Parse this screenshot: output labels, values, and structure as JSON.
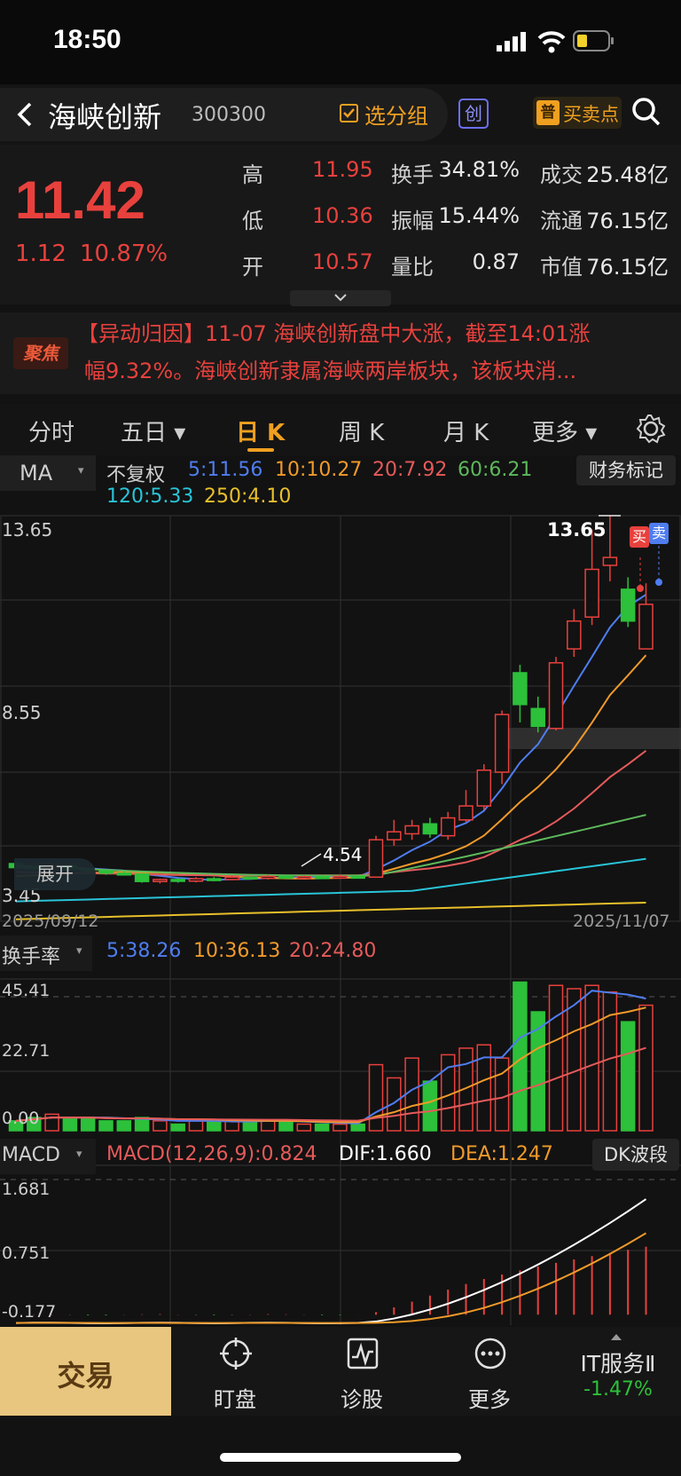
{
  "status_bar": {
    "time": "18:50"
  },
  "header": {
    "stock_name": "海峡创新",
    "stock_code": "300300",
    "group_label": "选分组",
    "chuang_badge": "创",
    "pu_badge": "普",
    "buy_sell_label": "买卖点"
  },
  "quote": {
    "price": "11.42",
    "change": "1.12",
    "change_pct": "10.87%",
    "rows": [
      {
        "l1": "高",
        "v1": "11.95",
        "l2": "换手",
        "v2": "34.81%",
        "l3": "成交",
        "v3": "25.48亿"
      },
      {
        "l1": "低",
        "v1": "10.36",
        "l2": "振幅",
        "v2": "15.44%",
        "l3": "流通",
        "v3": "76.15亿"
      },
      {
        "l1": "开",
        "v1": "10.57",
        "l2": "量比",
        "v2": "0.87",
        "l3": "市值",
        "v3": "76.15亿"
      }
    ]
  },
  "news": {
    "badge": "聚焦",
    "line1": "【异动归因】11-07 海峡创新盘中大涨，截至14:01涨",
    "line2": "幅9.32%。海峡创新隶属海峡两岸板块，该板块消..."
  },
  "tabs": [
    {
      "label": "分时",
      "active": false
    },
    {
      "label": "五日 ▾",
      "active": false
    },
    {
      "label": "日 K",
      "active": true
    },
    {
      "label": "周 K",
      "active": false
    },
    {
      "label": "月 K",
      "active": false
    },
    {
      "label": "更多 ▾",
      "active": false
    }
  ],
  "ma_bar": {
    "selector": "MA",
    "adjust": "不复权",
    "finance_mark": "财务标记",
    "items": [
      {
        "text": "5:11.56",
        "color": "#4f7df0"
      },
      {
        "text": "10:10.27",
        "color": "#f09a2a"
      },
      {
        "text": "20:7.92",
        "color": "#e55a5a"
      },
      {
        "text": "60:6.21",
        "color": "#5db85b"
      },
      {
        "text": "120:5.33",
        "color": "#29c4d8"
      },
      {
        "text": "250:4.10",
        "color": "#e8c02a"
      }
    ]
  },
  "kline": {
    "y_max_label": "13.65",
    "y_mid_label": "8.55",
    "y_min_label": "3.45",
    "high_note": "13.65",
    "low_note": "4.54",
    "buy_tag": "买",
    "sell_tag": "卖",
    "expand_label": "展开",
    "date_start": "2025/09/12",
    "date_end": "2025/11/07"
  },
  "turnover": {
    "selector": "换手率",
    "items": [
      {
        "text": "5:38.26",
        "color": "#4f7df0"
      },
      {
        "text": "10:36.13",
        "color": "#f09a2a"
      },
      {
        "text": "20:24.80",
        "color": "#e55a5a"
      }
    ],
    "y_labels": [
      "45.41",
      "22.71",
      "0.00"
    ]
  },
  "macd": {
    "selector": "MACD",
    "macd_text": "MACD(12,26,9):0.824",
    "dif_text": "DIF:1.660",
    "dea_text": "DEA:1.247",
    "dk_label": "DK波段",
    "y_labels": [
      "1.681",
      "0.751",
      "-0.177"
    ]
  },
  "bottom_nav": {
    "trade": "交易",
    "items": [
      {
        "label": "盯盘"
      },
      {
        "label": "诊股"
      },
      {
        "label": "更多"
      }
    ],
    "sector_name": "IT服务Ⅱ",
    "sector_change": "-1.47%"
  },
  "colors": {
    "up": "#e8413d",
    "down": "#2dc03a",
    "accent": "#f0a020"
  }
}
